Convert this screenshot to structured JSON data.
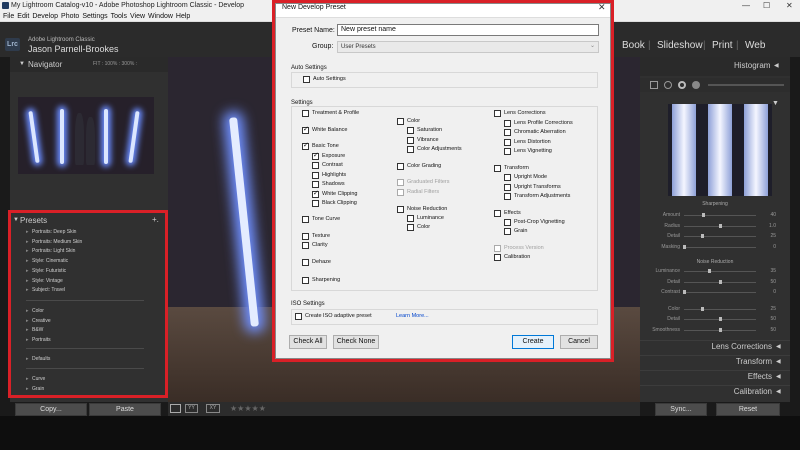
{
  "window": {
    "title": "My Lightroom Catalog-v10 - Adobe Photoshop Lightroom Classic - Develop",
    "controls": [
      "—",
      "☐",
      "✕"
    ]
  },
  "menu": [
    "File",
    "Edit",
    "Develop",
    "Photo",
    "Settings",
    "Tools",
    "View",
    "Window",
    "Help"
  ],
  "identity": {
    "logo": "Lrc",
    "app_name": "Adobe Lightroom Classic",
    "user": "Jason Parnell-Brookes"
  },
  "modules": [
    "Book",
    "Slideshow",
    "Print",
    "Web"
  ],
  "navigator": {
    "title": "Navigator",
    "zoom": "FIT  :  100%  :  300%  :"
  },
  "presets": {
    "title": "Presets",
    "add": "+.",
    "group1": [
      "Portraits: Deep Skin",
      "Portraits: Medium Skin",
      "Portraits: Light Skin",
      "Style: Cinematic",
      "Style: Futuristic",
      "Style: Vintage",
      "Subject: Travel"
    ],
    "group2": [
      "Color",
      "Creative",
      "B&W",
      "Portraits"
    ],
    "group3": [
      "Defaults"
    ],
    "group4": [
      "Curve",
      "Grain"
    ]
  },
  "left_buttons": {
    "copy": "Copy...",
    "paste": "Paste"
  },
  "toolstrip": {
    "stars": "★★★★★"
  },
  "right_panel": {
    "histogram": "Histogram",
    "sharpening": {
      "title": "Sharpening",
      "sliders": [
        {
          "label": "Amount",
          "value": "40",
          "level": 0.27
        },
        {
          "label": "Radius",
          "value": "1.0",
          "level": 0.5
        },
        {
          "label": "Detail",
          "value": "25",
          "level": 0.25
        },
        {
          "label": "Masking",
          "value": "0",
          "level": 0.0
        }
      ]
    },
    "noise_reduction": {
      "title": "Noise Reduction",
      "sliders": [
        {
          "label": "Luminance",
          "value": "35",
          "level": 0.35
        },
        {
          "label": "Detail",
          "value": "50",
          "level": 0.5
        },
        {
          "label": "Contrast",
          "value": "0",
          "level": 0.0
        },
        {
          "label": "Color",
          "value": "25",
          "level": 0.25
        },
        {
          "label": "Detail",
          "value": "50",
          "level": 0.5
        },
        {
          "label": "Smoothness",
          "value": "50",
          "level": 0.5
        }
      ]
    },
    "panels": [
      "Lens Corrections",
      "Transform",
      "Effects",
      "Calibration"
    ],
    "sync": "Sync...",
    "reset": "Reset"
  },
  "dialog": {
    "title": "New Develop Preset",
    "close": "✕",
    "preset_name_label": "Preset Name:",
    "preset_name_value": "New preset name",
    "group_label": "Group:",
    "group_value": "User Presets",
    "auto_settings_title": "Auto Settings",
    "auto_settings": {
      "label": "Auto Settings",
      "checked": false
    },
    "settings_title": "Settings",
    "col1": [
      {
        "label": "Treatment & Profile",
        "checked": false
      },
      {
        "label": "White Balance",
        "checked": true
      },
      {
        "label": "Basic Tone",
        "checked": true
      },
      {
        "label": "Exposure",
        "checked": true
      },
      {
        "label": "Contrast",
        "checked": false
      },
      {
        "label": "Highlights",
        "checked": false
      },
      {
        "label": "Shadows",
        "checked": false
      },
      {
        "label": "White Clipping",
        "checked": true
      },
      {
        "label": "Black Clipping",
        "checked": false
      },
      {
        "label": "Tone Curve",
        "checked": false
      },
      {
        "label": "Texture",
        "checked": false
      },
      {
        "label": "Clarity",
        "checked": false
      },
      {
        "label": "Dehaze",
        "checked": false
      },
      {
        "label": "Sharpening",
        "checked": false
      }
    ],
    "col2": [
      {
        "label": "Color",
        "checked": false
      },
      {
        "label": "Saturation",
        "checked": false
      },
      {
        "label": "Vibrance",
        "checked": false
      },
      {
        "label": "Color Adjustments",
        "checked": false
      },
      {
        "label": "Color Grading",
        "checked": false
      },
      {
        "label": "Graduated Filters",
        "checked": false,
        "disabled": true
      },
      {
        "label": "Radial Filters",
        "checked": false,
        "disabled": true
      },
      {
        "label": "Noise Reduction",
        "checked": false
      },
      {
        "label": "Luminance",
        "checked": false
      },
      {
        "label": "Color",
        "checked": false
      }
    ],
    "col3": [
      {
        "label": "Lens Corrections",
        "checked": false
      },
      {
        "label": "Lens Profile Corrections",
        "checked": false
      },
      {
        "label": "Chromatic Aberration",
        "checked": false
      },
      {
        "label": "Lens Distortion",
        "checked": false
      },
      {
        "label": "Lens Vignetting",
        "checked": false
      },
      {
        "label": "Transform",
        "checked": false
      },
      {
        "label": "Upright Mode",
        "checked": false
      },
      {
        "label": "Upright Transforms",
        "checked": false
      },
      {
        "label": "Transform Adjustments",
        "checked": false
      },
      {
        "label": "Effects",
        "checked": false
      },
      {
        "label": "Post-Crop Vignetting",
        "checked": false
      },
      {
        "label": "Grain",
        "checked": false
      },
      {
        "label": "Process Version",
        "checked": false,
        "disabled": true
      },
      {
        "label": "Calibration",
        "checked": false
      }
    ],
    "iso_title": "ISO Settings",
    "iso_adaptive": {
      "label": "Create ISO adaptive preset",
      "checked": false
    },
    "learn_more": "Learn More...",
    "check_all": "Check All",
    "check_none": "Check None",
    "create": "Create",
    "cancel": "Cancel"
  },
  "colors": {
    "highlight": "#d92027",
    "link": "#0044cc"
  }
}
